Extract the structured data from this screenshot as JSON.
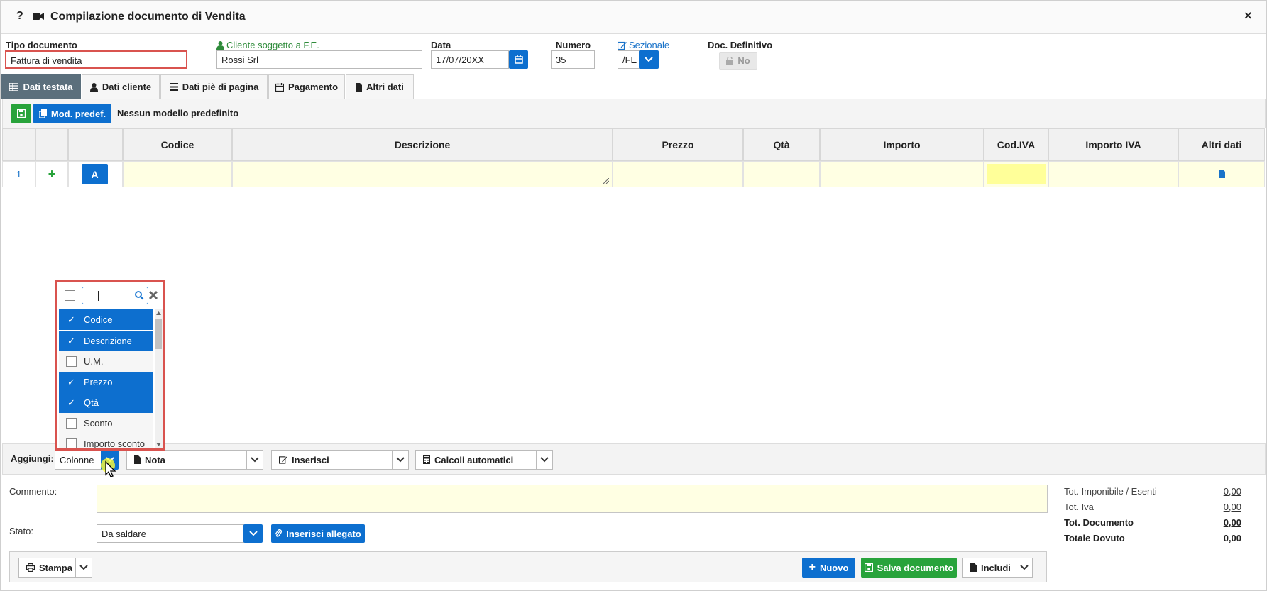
{
  "window": {
    "title": "Compilazione documento di Vendita",
    "help": "?",
    "close": "×"
  },
  "header": {
    "tipo_label": "Tipo documento",
    "tipo_value": "Fattura di vendita",
    "cliente_label": "Cliente soggetto a F.E.",
    "cliente_value": "Rossi Srl",
    "data_label": "Data",
    "data_value": "17/07/20XX",
    "numero_label": "Numero",
    "numero_value": "35",
    "sezionale_label": "Sezionale",
    "sezionale_value": "/FE",
    "definitivo_label": "Doc. Definitivo",
    "definitivo_value": "No"
  },
  "tabs": [
    {
      "label": "Dati testata"
    },
    {
      "label": "Dati cliente"
    },
    {
      "label": "Dati piè di pagina"
    },
    {
      "label": "Pagamento"
    },
    {
      "label": "Altri dati"
    }
  ],
  "toolbar": {
    "mod_label": "Mod. predef.",
    "model_text": "Nessun modello predefinito"
  },
  "grid": {
    "columns": [
      "Codice",
      "Descrizione",
      "Prezzo",
      "Qtà",
      "Importo",
      "Cod.IVA",
      "Importo IVA",
      "Altri dati"
    ],
    "row_number": "1",
    "row_plus": "+",
    "row_a": "A"
  },
  "columns_dropdown": {
    "items": [
      {
        "label": "Codice",
        "checked": true
      },
      {
        "label": "Descrizione",
        "checked": true
      },
      {
        "label": "U.M.",
        "checked": false
      },
      {
        "label": "Prezzo",
        "checked": true
      },
      {
        "label": "Qtà",
        "checked": true
      },
      {
        "label": "Sconto",
        "checked": false
      },
      {
        "label": "Importo sconto",
        "checked": false
      }
    ]
  },
  "add_bar": {
    "label": "Aggiungi:",
    "colonne": "Colonne",
    "nota": "Nota",
    "inserisci": "Inserisci",
    "calcoli": "Calcoli automatici"
  },
  "footer": {
    "commento_label": "Commento:",
    "stato_label": "Stato:",
    "stato_value": "Da saldare",
    "allegato_label": "Inserisci allegato",
    "stampa": "Stampa",
    "nuovo": "Nuovo",
    "salva": "Salva documento",
    "includi": "Includi"
  },
  "totals": [
    {
      "label": "Tot. Imponibile / Esenti",
      "value": "0,00"
    },
    {
      "label": "Tot. Iva",
      "value": "0,00"
    },
    {
      "label": "Tot. Documento",
      "value": "0,00"
    },
    {
      "label": "Totale Dovuto",
      "value": "0,00"
    }
  ],
  "colors": {
    "primary": "#0d6fcf",
    "success": "#28a33b",
    "tab_active": "#5b6f7c",
    "highlight": "#ffffe3",
    "danger": "#d9534f"
  }
}
